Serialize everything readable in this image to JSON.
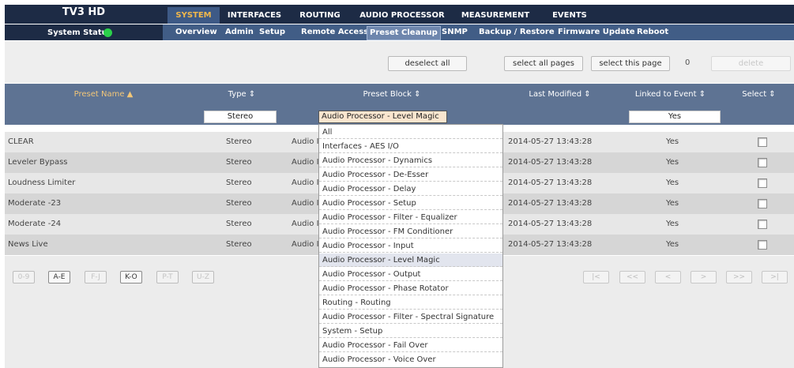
{
  "brand": "TV3 HD",
  "nav_tabs": [
    "SYSTEM",
    "INTERFACES",
    "ROUTING",
    "AUDIO PROCESSOR",
    "MEASUREMENT",
    "EVENTS"
  ],
  "system_status": "System Status",
  "subnav": [
    "Overview",
    "Admin",
    "Setup",
    "Remote Access",
    "Preset Cleanup",
    "SNMP",
    "Backup / Restore",
    "Firmware Update",
    "Reboot"
  ],
  "toolbar": {
    "deselect_all": "deselect all",
    "select_all_pages": "select all pages",
    "select_this_page": "select this page",
    "selected_count": "0",
    "delete": "delete"
  },
  "columns": {
    "preset_name": "Preset Name ▲",
    "type": "Type ⇕",
    "preset_block": "Preset Block ⇕",
    "last_modified": "Last Modified ⇕",
    "linked_to_event": "Linked to Event ⇕",
    "select": "Select ⇕"
  },
  "filters": {
    "type": "Stereo",
    "preset_block": "Audio Processor - Level Magic",
    "linked": "Yes"
  },
  "rows": [
    {
      "name": "CLEAR",
      "type": "Stereo",
      "block": "Audio I",
      "modified": "2014-05-27 13:43:28",
      "linked": "Yes"
    },
    {
      "name": "Leveler Bypass",
      "type": "Stereo",
      "block": "Audio I",
      "modified": "2014-05-27 13:43:28",
      "linked": "Yes"
    },
    {
      "name": "Loudness Limiter",
      "type": "Stereo",
      "block": "Audio I",
      "modified": "2014-05-27 13:43:28",
      "linked": "Yes"
    },
    {
      "name": "Moderate -23",
      "type": "Stereo",
      "block": "Audio I",
      "modified": "2014-05-27 13:43:28",
      "linked": "Yes"
    },
    {
      "name": "Moderate -24",
      "type": "Stereo",
      "block": "Audio I",
      "modified": "2014-05-27 13:43:28",
      "linked": "Yes"
    },
    {
      "name": "News Live",
      "type": "Stereo",
      "block": "Audio I",
      "modified": "2014-05-27 13:43:28",
      "linked": "Yes"
    }
  ],
  "alpha_filters": [
    "0-9",
    "A-E",
    "F-J",
    "K-O",
    "P-T",
    "U-Z"
  ],
  "pager": [
    "|<",
    "<<",
    "<",
    ">",
    ">>",
    ">|"
  ],
  "dropdown_options": [
    "All",
    "Interfaces - AES I/O",
    "Audio Processor - Dynamics",
    "Audio Processor - De-Esser",
    "Audio Processor - Delay",
    "Audio Processor - Setup",
    "Audio Processor - Filter - Equalizer",
    "Audio Processor - FM Conditioner",
    "Audio Processor - Input",
    "Audio Processor - Level Magic",
    "Audio Processor - Output",
    "Audio Processor - Phase Rotator",
    "Routing - Routing",
    "Audio Processor - Filter - Spectral Signature",
    "System - Setup",
    "Audio Processor - Fail Over",
    "Audio Processor - Voice Over"
  ],
  "colors": {
    "nav_bg": "#1d2b45",
    "subnav_bg": "#415d86",
    "header_bg": "#5e7393",
    "active_tab_text": "#f2b84b",
    "status_ok": "#2bd04a"
  }
}
